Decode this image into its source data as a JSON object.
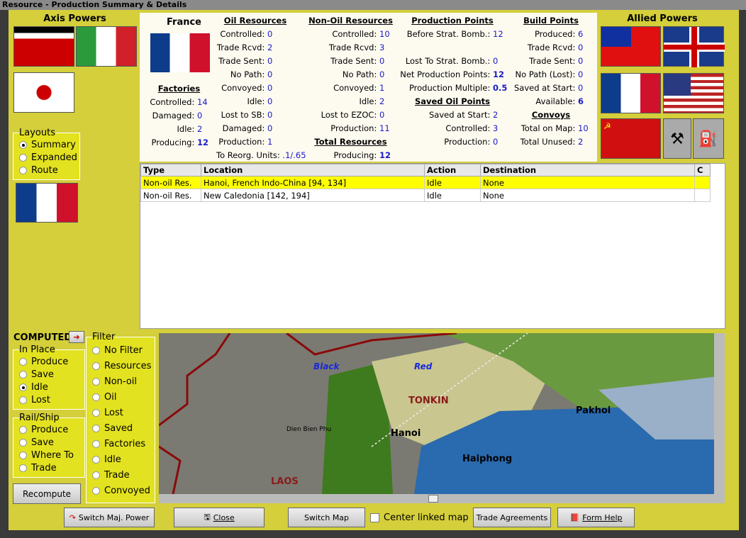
{
  "window": {
    "title": "Resource - Production Summary & Details"
  },
  "axis": {
    "title": "Axis Powers"
  },
  "allied": {
    "title": "Allied Powers"
  },
  "layouts": {
    "title": "Layouts",
    "options": [
      "Summary",
      "Expanded",
      "Route"
    ],
    "selected": "Summary"
  },
  "country": {
    "name": "France"
  },
  "factories": {
    "title": "Factories",
    "rows": [
      {
        "label": "Controlled:",
        "value": "14"
      },
      {
        "label": "Damaged:",
        "value": "0"
      },
      {
        "label": "Idle:",
        "value": "2"
      },
      {
        "label": "Producing:",
        "value": "12"
      }
    ]
  },
  "oil": {
    "title": "Oil Resources",
    "rows": [
      {
        "label": "Controlled:",
        "value": "0"
      },
      {
        "label": "Trade Rcvd:",
        "value": "2"
      },
      {
        "label": "Trade Sent:",
        "value": "0"
      },
      {
        "label": "No Path:",
        "value": "0"
      },
      {
        "label": "Convoyed:",
        "value": "0"
      },
      {
        "label": "Idle:",
        "value": "0"
      },
      {
        "label": "Lost to SB:",
        "value": "0"
      },
      {
        "label": "Damaged:",
        "value": "0"
      },
      {
        "label": "Production:",
        "value": "1"
      },
      {
        "label": "To Reorg. Units:",
        "value": ".1/.65"
      }
    ]
  },
  "nonoil": {
    "title": "Non-Oil Resources",
    "rows": [
      {
        "label": "Controlled:",
        "value": "10"
      },
      {
        "label": "Trade Rcvd:",
        "value": "3"
      },
      {
        "label": "Trade Sent:",
        "value": "0"
      },
      {
        "label": "No Path:",
        "value": "0"
      },
      {
        "label": "Convoyed:",
        "value": "1"
      },
      {
        "label": "Idle:",
        "value": "2"
      },
      {
        "label": "Lost to EZOC:",
        "value": "0"
      },
      {
        "label": "Production:",
        "value": "11"
      }
    ]
  },
  "total": {
    "title": "Total Resources",
    "label": "Producing:",
    "value": "12"
  },
  "pp": {
    "title": "Production Points",
    "rows": [
      {
        "label": "Before Strat. Bomb.:",
        "value": "12"
      },
      {
        "label": "",
        "value": ""
      },
      {
        "label": "Lost To Strat. Bomb.:",
        "value": "0"
      },
      {
        "label": "Net Production Points:",
        "value": "12"
      },
      {
        "label": "Production Multiple:",
        "value": "0.5"
      }
    ]
  },
  "savedoil": {
    "title": "Saved Oil Points",
    "rows": [
      {
        "label": "Saved at Start:",
        "value": "2"
      },
      {
        "label": "Controlled:",
        "value": "3"
      },
      {
        "label": "Production:",
        "value": "0"
      }
    ]
  },
  "bp": {
    "title": "Build Points",
    "rows": [
      {
        "label": "Produced:",
        "value": "6"
      },
      {
        "label": "Trade Rcvd:",
        "value": "0"
      },
      {
        "label": "Trade Sent:",
        "value": "0"
      },
      {
        "label": "No Path (Lost):",
        "value": "0"
      },
      {
        "label": "Saved at Start:",
        "value": "0"
      },
      {
        "label": "Available:",
        "value": "6"
      }
    ]
  },
  "convoys": {
    "title": "Convoys",
    "rows": [
      {
        "label": "Total on Map:",
        "value": "10"
      },
      {
        "label": "Total Unused:",
        "value": "2"
      }
    ]
  },
  "table": {
    "headers": [
      "Type",
      "Location",
      "Action",
      "Destination",
      "C"
    ],
    "rows": [
      [
        "Non-oil Res.",
        "Hanoi, French Indo-China [94, 134]",
        "Idle",
        "None",
        ""
      ],
      [
        "Non-oil Res.",
        "New Caledonia [142, 194]",
        "Idle",
        "None",
        ""
      ]
    ]
  },
  "computed": {
    "label": "COMPUTED"
  },
  "inplace": {
    "title": "In Place",
    "options": [
      "Produce",
      "Save",
      "Idle",
      "Lost"
    ],
    "selected": "Idle"
  },
  "railship": {
    "title": "Rail/Ship",
    "options": [
      "Produce",
      "Save",
      "Where To",
      "Trade"
    ]
  },
  "filter": {
    "title": "Filter",
    "options": [
      "No Filter",
      "Resources",
      "Non-oil",
      "Oil",
      "Lost",
      "Saved",
      "Factories",
      "Idle",
      "Trade",
      "Convoyed"
    ]
  },
  "buttons": {
    "recompute": "Recompute",
    "switch_power": "Switch Maj. Power",
    "close": "Close",
    "switch_map": "Switch Map",
    "center_linked": "Center linked map",
    "trade": "Trade Agreements",
    "help": "Form Help"
  },
  "map": {
    "labels": {
      "black": "Black",
      "red": "Red",
      "tonkin": "TONKIN",
      "dbp": "Dien Bien Phu",
      "hanoi": "Hanoi",
      "haiphong": "Haiphong",
      "pakhoi": "Pakhoi",
      "laos": "LAOS"
    }
  },
  "colors": {
    "selected_row": "#ffff00",
    "value": "#1a1ac8",
    "panel": "#d4cf3a"
  }
}
